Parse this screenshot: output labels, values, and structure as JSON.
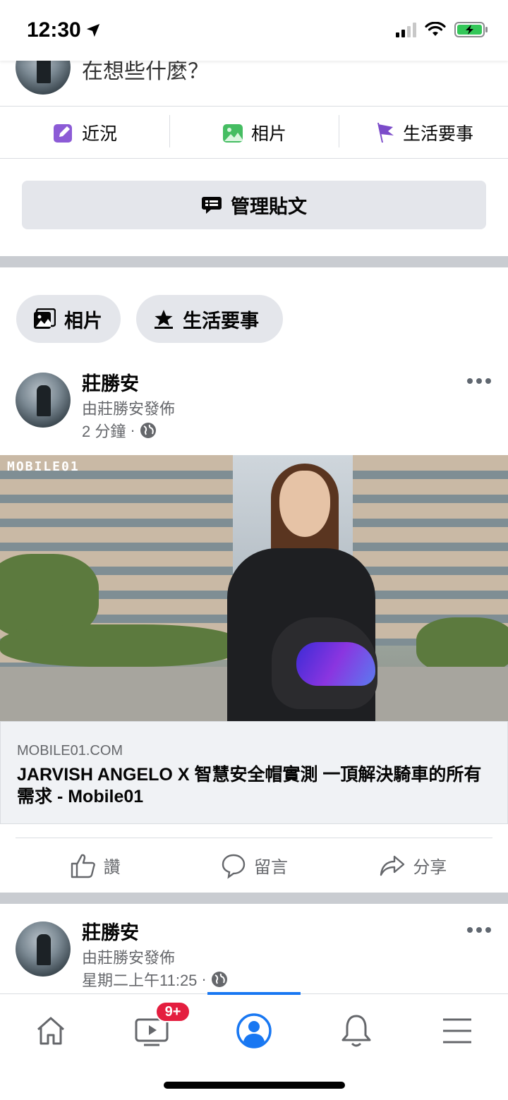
{
  "status_bar": {
    "time": "12:30"
  },
  "composer": {
    "prompt": "在想些什麼？"
  },
  "post_actions": [
    {
      "label": "近況",
      "icon": "edit-icon",
      "color": "#8c5bd6"
    },
    {
      "label": "相片",
      "icon": "photo-icon",
      "color": "#45bd62"
    },
    {
      "label": "生活要事",
      "icon": "flag-icon",
      "color": "#7b4bc9"
    }
  ],
  "manage_posts": {
    "label": "管理貼文"
  },
  "filter_chips": [
    {
      "label": "相片",
      "icon": "photos-icon"
    },
    {
      "label": "生活要事",
      "icon": "life-event-icon"
    }
  ],
  "posts": [
    {
      "author": "莊勝安",
      "subtitle": "由莊勝安發佈",
      "time": "2 分鐘",
      "separator": "·",
      "link": {
        "watermark": "MOBILE01",
        "domain": "MOBILE01.COM",
        "title": "JARVISH ANGELO X 智慧安全帽實測 一頂解決騎車的所有需求 - Mobile01"
      },
      "reactions": {
        "like": "讚",
        "comment": "留言",
        "share": "分享"
      }
    },
    {
      "author": "莊勝安",
      "subtitle": "由莊勝安發佈",
      "time": "星期二上午11:25",
      "separator": "·"
    }
  ],
  "tab_bar": {
    "badge": "9+",
    "accent_color": "#1877f2",
    "tabs": [
      "home-icon",
      "watch-icon",
      "profile-icon",
      "notifications-icon",
      "menu-icon"
    ]
  }
}
